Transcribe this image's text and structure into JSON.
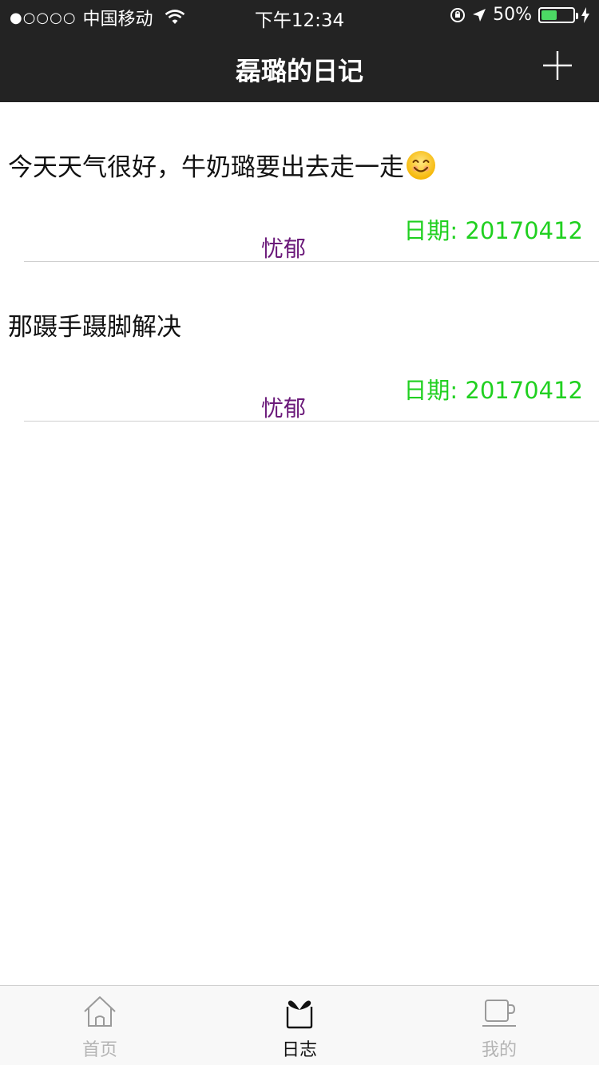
{
  "status_bar": {
    "signal_dots": "●○○○○",
    "carrier": "中国移动",
    "time": "下午12:34",
    "battery_percent": "50%",
    "battery_level": 0.5,
    "battery_color": "#4cd964"
  },
  "navbar": {
    "title": "磊璐的日记",
    "add_icon": "plus-icon"
  },
  "entries": [
    {
      "content": "今天天气很好，牛奶璐要出去走一走",
      "emoji": "smiling-face-emoji",
      "date": "日期: 20170412",
      "mood": "忧郁"
    },
    {
      "content": "那蹑手蹑脚解决",
      "date": "日期: 20170412",
      "mood": "忧郁"
    }
  ],
  "colors": {
    "nav_background": "#232323",
    "date_text": "#20d020",
    "mood_text": "#6b1a7a"
  },
  "tabbar": {
    "tabs": [
      {
        "label": "首页",
        "icon": "home-icon",
        "active": false
      },
      {
        "label": "日志",
        "icon": "journal-icon",
        "active": true
      },
      {
        "label": "我的",
        "icon": "mug-icon",
        "active": false
      }
    ]
  }
}
